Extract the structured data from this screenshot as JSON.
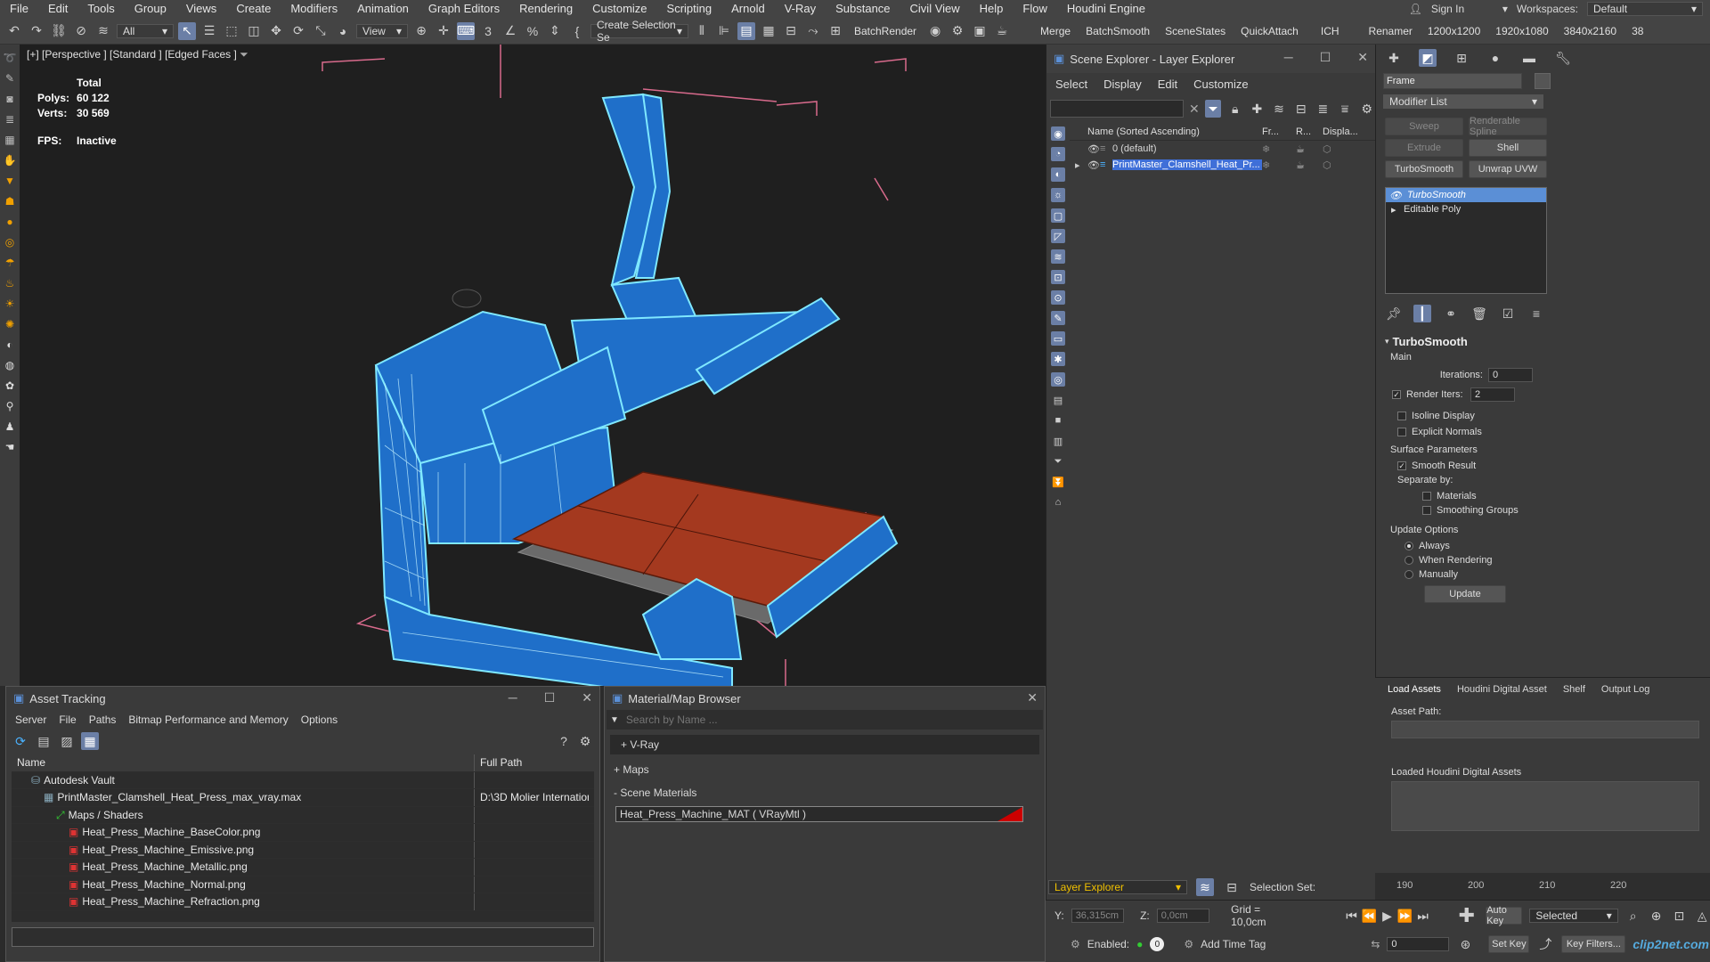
{
  "menubar": {
    "items": [
      "File",
      "Edit",
      "Tools",
      "Group",
      "Views",
      "Create",
      "Modifiers",
      "Animation",
      "Graph Editors",
      "Rendering",
      "Customize",
      "Scripting",
      "Arnold",
      "V-Ray",
      "Substance",
      "Civil View",
      "Help",
      "Flow",
      "Houdini Engine"
    ],
    "sign_in": "Sign In",
    "workspaces_label": "Workspaces:",
    "workspace_value": "Default"
  },
  "toolbar": {
    "filter_value": "All",
    "view_value": "View",
    "selection_set": "Create Selection Se",
    "batch_render": "BatchRender",
    "merge": "Merge",
    "batchsmooth": "BatchSmooth",
    "scenestates": "SceneStates",
    "quickattach": "QuickAttach",
    "ich": "ICH",
    "renamer": "Renamer",
    "res1": "1200x1200",
    "res2": "1920x1080",
    "res3": "3840x2160",
    "res4": "38"
  },
  "viewport": {
    "label": "[+] [Perspective ] [Standard ] [Edged Faces ]",
    "stats": {
      "total_label": "Total",
      "polys_label": "Polys:",
      "polys_value": "60 122",
      "verts_label": "Verts:",
      "verts_value": "30 569",
      "fps_label": "FPS:",
      "fps_value": "Inactive"
    }
  },
  "scene_explorer": {
    "title": "Scene Explorer - Layer Explorer",
    "menu": [
      "Select",
      "Display",
      "Edit",
      "Customize"
    ],
    "columns": {
      "name": "Name (Sorted Ascending)",
      "fr": "Fr...",
      "r": "R...",
      "disp": "Displa..."
    },
    "rows": [
      {
        "name": "0 (default)"
      },
      {
        "name": "PrintMaster_Clamshell_Heat_Pr..."
      }
    ],
    "footer_dropdown": "Layer Explorer",
    "selection_set_label": "Selection Set:"
  },
  "command_panel": {
    "object_name": "Frame",
    "modifier_list": "Modifier List",
    "buttons": [
      {
        "label": "Sweep",
        "enabled": false
      },
      {
        "label": "Renderable Spline",
        "enabled": false
      },
      {
        "label": "Extrude",
        "enabled": false
      },
      {
        "label": "Shell",
        "enabled": true
      },
      {
        "label": "TurboSmooth",
        "enabled": true
      },
      {
        "label": "Unwrap UVW",
        "enabled": true
      }
    ],
    "stack": [
      "TurboSmooth",
      "Editable Poly"
    ],
    "turbosmooth": {
      "title": "TurboSmooth",
      "main": "Main",
      "iterations_label": "Iterations:",
      "iterations_value": "0",
      "render_iters_label": "Render Iters:",
      "render_iters_value": "2",
      "isoline": "Isoline Display",
      "explicit_normals": "Explicit Normals",
      "surface_params": "Surface Parameters",
      "smooth_result": "Smooth Result",
      "separate_by": "Separate by:",
      "materials": "Materials",
      "smoothing_groups": "Smoothing Groups",
      "update_options": "Update Options",
      "always": "Always",
      "when_rendering": "When Rendering",
      "manually": "Manually",
      "update_button": "Update"
    }
  },
  "houdini": {
    "tabs": [
      "Load Assets",
      "Houdini Digital Asset",
      "Shelf",
      "Output Log"
    ],
    "asset_path_label": "Asset Path:",
    "loaded_label": "Loaded Houdini Digital Assets"
  },
  "timeline": {
    "ticks": [
      "190",
      "200",
      "210",
      "220"
    ]
  },
  "asset_tracking": {
    "title": "Asset Tracking",
    "menu": [
      "Server",
      "File",
      "Paths",
      "Bitmap Performance and Memory",
      "Options"
    ],
    "col_name": "Name",
    "col_path": "Full Path",
    "rows": [
      {
        "name": "Autodesk Vault",
        "path": "",
        "indent": 1
      },
      {
        "name": "PrintMaster_Clamshell_Heat_Press_max_vray.max",
        "path": "D:\\3D Molier Internation",
        "indent": 2
      },
      {
        "name": "Maps / Shaders",
        "path": "",
        "indent": 3
      },
      {
        "name": "Heat_Press_Machine_BaseColor.png",
        "path": "",
        "indent": 4
      },
      {
        "name": "Heat_Press_Machine_Emissive.png",
        "path": "",
        "indent": 4
      },
      {
        "name": "Heat_Press_Machine_Metallic.png",
        "path": "",
        "indent": 4
      },
      {
        "name": "Heat_Press_Machine_Normal.png",
        "path": "",
        "indent": 4
      },
      {
        "name": "Heat_Press_Machine_Refraction.png",
        "path": "",
        "indent": 4
      }
    ]
  },
  "material_browser": {
    "title": "Material/Map Browser",
    "search_placeholder": "Search by Name ...",
    "groups": [
      "+ V-Ray",
      "+ Maps",
      "- Scene Materials"
    ],
    "material": "Heat_Press_Machine_MAT  ( VRayMtl )"
  },
  "statusbar": {
    "y_label": "Y:",
    "y_value": "36,315cm",
    "z_label": "Z:",
    "z_value": "0,0cm",
    "grid": "Grid = 10,0cm",
    "enabled_label": "Enabled:",
    "add_time_tag": "Add Time Tag",
    "auto_key": "Auto Key",
    "set_key": "Set Key",
    "selected": "Selected",
    "key_filters": "Key Filters...",
    "frame_value": "0",
    "watermark": "clip2net.com"
  },
  "colors": {
    "accent": "#5b8fd6",
    "model_blue": "#1f6fc9",
    "platen": "#a4391f",
    "selection": "#3f6fd8"
  }
}
